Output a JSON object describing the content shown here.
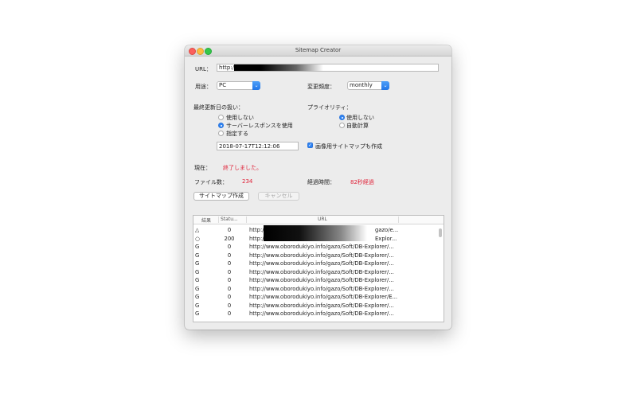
{
  "window": {
    "title": "Sitemap Creator"
  },
  "url_label": "URL：",
  "url_value": "http:/",
  "usage": {
    "label": "用途：",
    "value": "PC"
  },
  "frequency": {
    "label": "変更頻度：",
    "value": "monthly"
  },
  "lastmod": {
    "label": "最終更新日の扱い：",
    "options": [
      "使用しない",
      "サーバーレスポンスを使用",
      "指定する"
    ],
    "selected_index": 1,
    "date_value": "2018-07-17T12:12:06"
  },
  "priority": {
    "label": "プライオリティ：",
    "options": [
      "使用しない",
      "自動計算"
    ],
    "selected_index": 0
  },
  "image_sitemap": {
    "label": "画像用サイトマップも作成",
    "checked": true
  },
  "status": {
    "current_label": "現在：",
    "current_value": "終了しました。",
    "files_label": "ファイル数：",
    "files_value": "234",
    "elapsed_label": "経過時間：",
    "elapsed_value": "82秒経過"
  },
  "buttons": {
    "create": "サイトマップ作成",
    "cancel": "キャンセル"
  },
  "table": {
    "headers": [
      "結果",
      "Statu...",
      "URL"
    ],
    "rows": [
      {
        "result": "△",
        "status": "0",
        "url": "http:/",
        "url_tail": "gazo/e..."
      },
      {
        "result": "○",
        "status": "200",
        "url": "http:/",
        "url_tail": "Explor..."
      },
      {
        "result": "G",
        "status": "0",
        "url": "http://www.oborodukiyo.info/gazo/Soft/DB-Explorer/..."
      },
      {
        "result": "G",
        "status": "0",
        "url": "http://www.oborodukiyo.info/gazo/Soft/DB-Explorer/..."
      },
      {
        "result": "G",
        "status": "0",
        "url": "http://www.oborodukiyo.info/gazo/Soft/DB-Explorer/..."
      },
      {
        "result": "G",
        "status": "0",
        "url": "http://www.oborodukiyo.info/gazo/Soft/DB-Explorer/..."
      },
      {
        "result": "G",
        "status": "0",
        "url": "http://www.oborodukiyo.info/gazo/Soft/DB-Explorer/..."
      },
      {
        "result": "G",
        "status": "0",
        "url": "http://www.oborodukiyo.info/gazo/Soft/DB-Explorer/..."
      },
      {
        "result": "G",
        "status": "0",
        "url": "http://www.oborodukiyo.info/gazo/Soft/DB-Explorer/E..."
      },
      {
        "result": "G",
        "status": "0",
        "url": "http://www.oborodukiyo.info/gazo/Soft/DB-Explorer/..."
      },
      {
        "result": "G",
        "status": "0",
        "url": "http://www.oborodukiyo.info/gazo/Soft/DB-Explorer/..."
      }
    ]
  },
  "colors": {
    "accent": "#2f83f2",
    "status_red": "#e0243a"
  }
}
